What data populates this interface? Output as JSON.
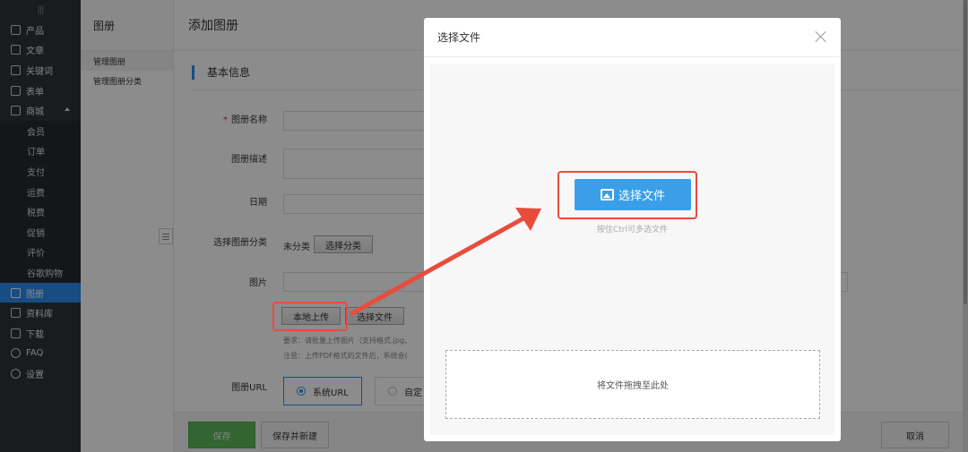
{
  "nav": {
    "items": [
      {
        "label": "产品",
        "icon": "grid-icon"
      },
      {
        "label": "文章",
        "icon": "document-icon"
      },
      {
        "label": "关键词",
        "icon": "keyword-icon"
      },
      {
        "label": "表单",
        "icon": "form-icon"
      },
      {
        "label": "商城",
        "icon": "shop-icon"
      },
      {
        "label": "会员"
      },
      {
        "label": "订单"
      },
      {
        "label": "支付"
      },
      {
        "label": "运费"
      },
      {
        "label": "税费"
      },
      {
        "label": "促销"
      },
      {
        "label": "评价"
      },
      {
        "label": "谷歌购物"
      },
      {
        "label": "图册",
        "icon": "album-icon"
      },
      {
        "label": "资料库",
        "icon": "library-icon"
      },
      {
        "label": "下载",
        "icon": "download-icon"
      },
      {
        "label": "FAQ",
        "icon": "faq-icon"
      },
      {
        "label": "设置",
        "icon": "gear-icon"
      }
    ]
  },
  "col2": {
    "title": "图册",
    "links": [
      "管理图册",
      "管理图册分类"
    ]
  },
  "main": {
    "title": "添加图册",
    "section": "基本信息",
    "fields": {
      "name": "图册名称",
      "desc": "图册描述",
      "date": "日期",
      "category": "选择图册分类",
      "category_value": "未分类",
      "category_btn": "选择分类",
      "image": "图片",
      "upload_btn": "本地上传",
      "select_file_btn": "选择文件",
      "hint1": "要求：请批量上传图片（支持格式.jpg、",
      "hint2": "注意：上传PDF格式的文件后，系统会(",
      "url": "图册URL",
      "url_system": "系统URL",
      "url_custom": "自定"
    },
    "footer": {
      "save": "保存",
      "save_new": "保存并新建",
      "cancel": "取消"
    }
  },
  "modal": {
    "title": "选择文件",
    "pick_btn": "选择文件",
    "pick_hint": "按住Ctrl可多选文件",
    "drop_text": "将文件拖拽至此处"
  },
  "colors": {
    "accent": "#2d8cf0",
    "highlight": "#e84c3d",
    "save_green": "#5cb85c"
  }
}
